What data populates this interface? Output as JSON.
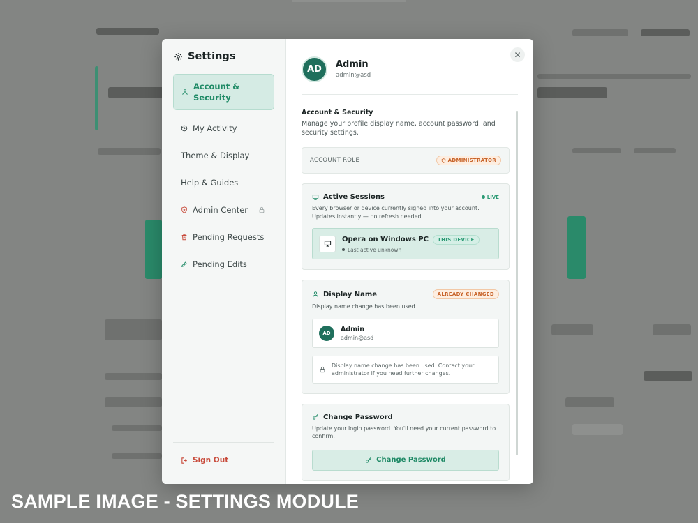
{
  "settings": {
    "title": "Settings",
    "nav": [
      {
        "label": "Account & Security",
        "icon": "user-icon"
      },
      {
        "label": "My Activity",
        "icon": "history-icon"
      },
      {
        "label": "Theme & Display",
        "icon": ""
      },
      {
        "label": "Help & Guides",
        "icon": ""
      },
      {
        "label": "Admin Center",
        "icon": "shield-icon"
      },
      {
        "label": "Pending Requests",
        "icon": "trash-icon"
      },
      {
        "label": "Pending Edits",
        "icon": "pencil-icon"
      }
    ],
    "sign_out": "Sign Out"
  },
  "profile": {
    "initials": "AD",
    "name": "Admin",
    "email": "admin@asd"
  },
  "section": {
    "title": "Account & Security",
    "description": "Manage your profile display name, account password, and security settings."
  },
  "role": {
    "label": "ACCOUNT ROLE",
    "value": "ADMINISTRATOR"
  },
  "sessions": {
    "title": "Active Sessions",
    "status": "LIVE",
    "description": "Every browser or device currently signed into your account. Updates instantly — no refresh needed.",
    "device_name": "Opera on Windows PC",
    "device_badge": "THIS DEVICE",
    "device_last_active": "Last active unknown"
  },
  "display_name": {
    "title": "Display Name",
    "badge": "ALREADY CHANGED",
    "description": "Display name change has been used.",
    "current_initials": "AD",
    "current_name": "Admin",
    "current_email": "admin@asd",
    "lock_note": "Display name change has been used. Contact your administrator if you need further changes."
  },
  "password": {
    "title": "Change Password",
    "description": "Update your login password. You'll need your current password to confirm.",
    "button": "Change Password"
  },
  "caption": "SAMPLE IMAGE - SETTINGS MODULE",
  "colors": {
    "accent": "#1f8a66",
    "danger": "#c84a3a",
    "warning": "#c8642a"
  }
}
